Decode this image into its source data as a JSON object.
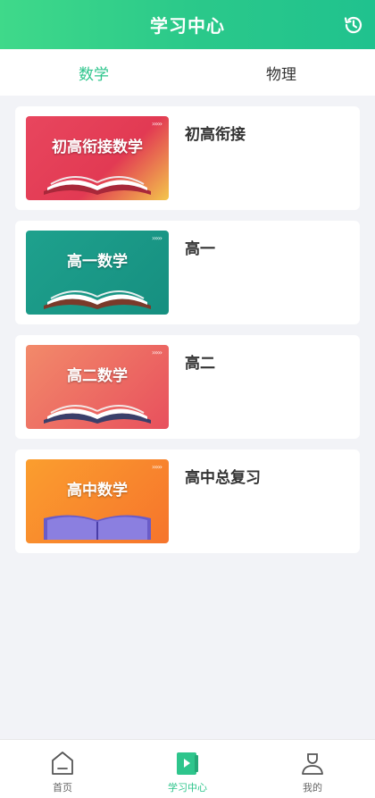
{
  "header": {
    "title": "学习中心",
    "history_icon": "history-icon"
  },
  "tabs": [
    {
      "label": "数学",
      "active": true
    },
    {
      "label": "物理",
      "active": false
    }
  ],
  "courses": [
    {
      "cover_title": "初高衔接数学",
      "name": "初高衔接"
    },
    {
      "cover_title": "高一数学",
      "name": "高一"
    },
    {
      "cover_title": "高二数学",
      "name": "高二"
    },
    {
      "cover_title": "高中数学",
      "name": "高中总复习"
    }
  ],
  "bottom_nav": [
    {
      "label": "首页",
      "icon": "home-icon",
      "active": false
    },
    {
      "label": "学习中心",
      "icon": "study-icon",
      "active": true
    },
    {
      "label": "我的",
      "icon": "profile-icon",
      "active": false
    }
  ],
  "colors": {
    "accent": "#2ec58c",
    "header_start": "#3fd98a",
    "header_end": "#20c28e"
  }
}
